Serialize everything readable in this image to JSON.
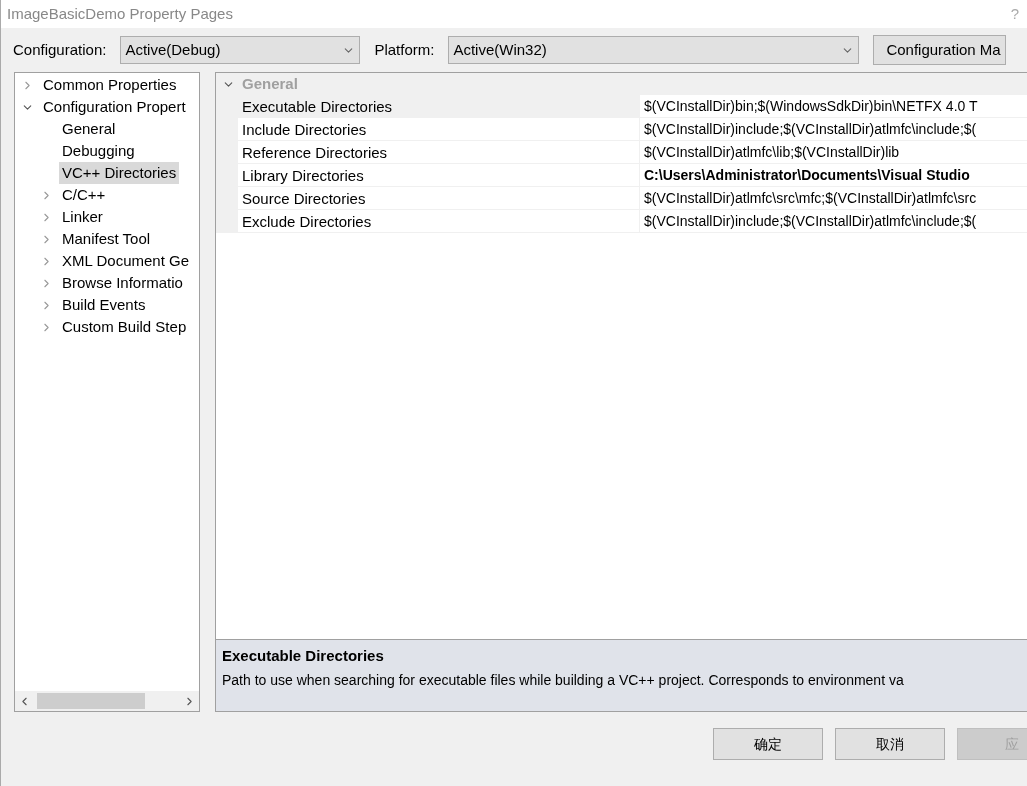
{
  "window": {
    "title": "ImageBasicDemo Property Pages",
    "help": "?"
  },
  "configuration": {
    "label": "Configuration:",
    "value": "Active(Debug)"
  },
  "platform": {
    "label": "Platform:",
    "value": "Active(Win32)"
  },
  "config_manager_button": "Configuration Ma",
  "tree": [
    {
      "label": "Common Properties",
      "expanded": false,
      "selected": false
    },
    {
      "label": "Configuration Propert",
      "expanded": true,
      "selected": false,
      "children": [
        {
          "label": "General",
          "selected": false
        },
        {
          "label": "Debugging",
          "selected": false
        },
        {
          "label": "VC++ Directories",
          "selected": true
        },
        {
          "label": "C/C++",
          "expanded": false,
          "selected": false
        },
        {
          "label": "Linker",
          "expanded": false,
          "selected": false
        },
        {
          "label": "Manifest Tool",
          "expanded": false,
          "selected": false
        },
        {
          "label": "XML Document Ge",
          "expanded": false,
          "selected": false
        },
        {
          "label": "Browse Informatio",
          "expanded": false,
          "selected": false
        },
        {
          "label": "Build Events",
          "expanded": false,
          "selected": false
        },
        {
          "label": "Custom Build Step",
          "expanded": false,
          "selected": false
        }
      ]
    }
  ],
  "grid": {
    "section": {
      "label": "General",
      "expanded": true
    },
    "rows": [
      {
        "name": "Executable Directories",
        "value": "$(VCInstallDir)bin;$(WindowsSdkDir)bin\\NETFX 4.0 T",
        "selected": true,
        "modified": false
      },
      {
        "name": "Include Directories",
        "value": "$(VCInstallDir)include;$(VCInstallDir)atlmfc\\include;$(",
        "selected": false,
        "modified": false
      },
      {
        "name": "Reference Directories",
        "value": "$(VCInstallDir)atlmfc\\lib;$(VCInstallDir)lib",
        "selected": false,
        "modified": false
      },
      {
        "name": "Library Directories",
        "value": "C:\\Users\\Administrator\\Documents\\Visual Studio",
        "selected": false,
        "modified": true
      },
      {
        "name": "Source Directories",
        "value": "$(VCInstallDir)atlmfc\\src\\mfc;$(VCInstallDir)atlmfc\\src",
        "selected": false,
        "modified": false
      },
      {
        "name": "Exclude Directories",
        "value": "$(VCInstallDir)include;$(VCInstallDir)atlmfc\\include;$(",
        "selected": false,
        "modified": false
      }
    ]
  },
  "description": {
    "title": "Executable Directories",
    "text": "Path to use when searching for executable files while building a VC++ project.  Corresponds to environment va"
  },
  "buttons": [
    {
      "label": "确定",
      "disabled": false
    },
    {
      "label": "取消",
      "disabled": false
    },
    {
      "label": "应",
      "disabled": true
    }
  ]
}
